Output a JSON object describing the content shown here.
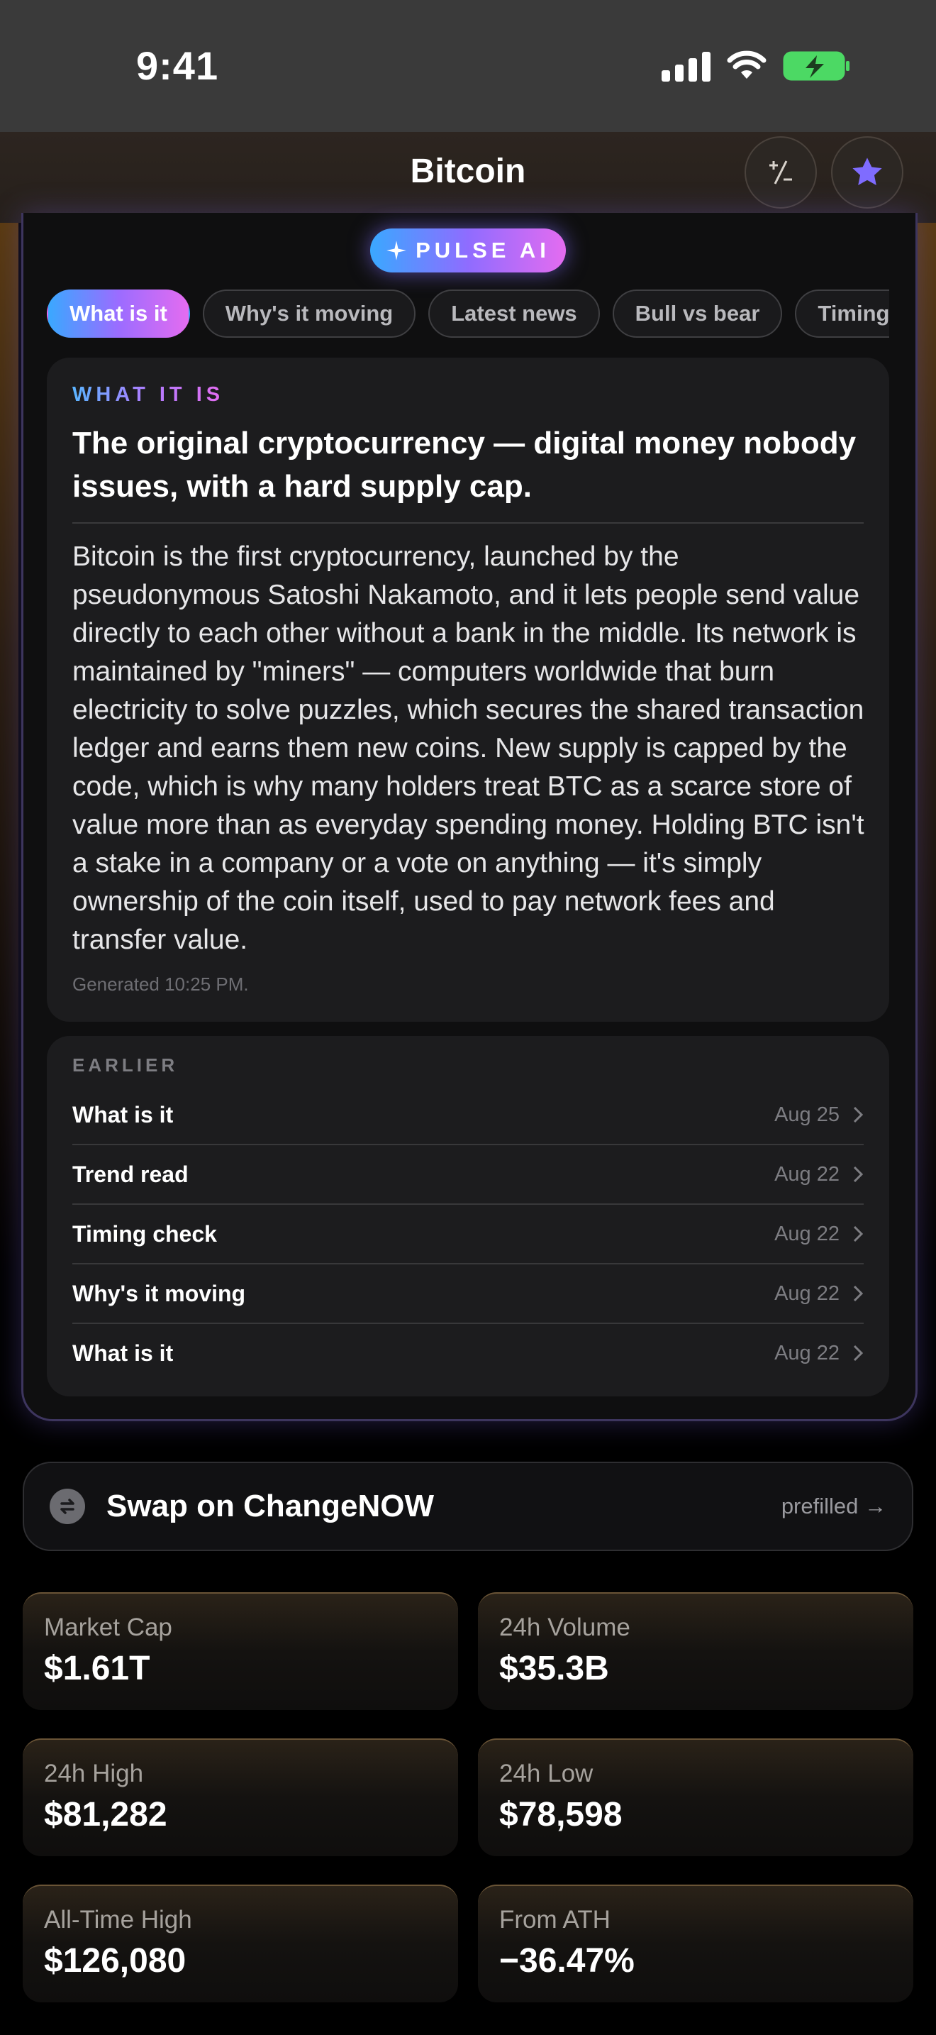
{
  "status_bar": {
    "time": "9:41"
  },
  "nav": {
    "title": "Bitcoin"
  },
  "pulse_ai": {
    "badge": "PULSE AI",
    "tabs": [
      "What is it",
      "Why's it moving",
      "Latest news",
      "Bull vs bear",
      "Timing check"
    ],
    "active_tab": 0,
    "eyebrow": "WHAT IT IS",
    "headline": "The original cryptocurrency — digital money nobody issues, with a hard supply cap.",
    "body": "Bitcoin is the first cryptocurrency, launched by the pseudonymous Satoshi Nakamoto, and it lets people send value directly to each other without a bank in the middle. Its network is maintained by \"miners\" — computers worldwide that burn electricity to solve puzzles, which secures the shared transaction ledger and earns them new coins. New supply is capped by the code, which is why many holders treat BTC as a scarce store of value more than as everyday spending money. Holding BTC isn't a stake in a company or a vote on anything — it's simply ownership of the coin itself, used to pay network fees and transfer value.",
    "generated": "Generated 10:25 PM.",
    "earlier_label": "EARLIER",
    "history": [
      {
        "label": "What is it",
        "date": "Aug 25"
      },
      {
        "label": "Trend read",
        "date": "Aug 22"
      },
      {
        "label": "Timing check",
        "date": "Aug 22"
      },
      {
        "label": "Why's it moving",
        "date": "Aug 22"
      },
      {
        "label": "What is it",
        "date": "Aug 22"
      }
    ]
  },
  "swap": {
    "label": "Swap on ChangeNOW",
    "prefilled": "prefilled →"
  },
  "stats": [
    {
      "key": "Market Cap",
      "value": "$1.61T"
    },
    {
      "key": "24h Volume",
      "value": "$35.3B"
    },
    {
      "key": "24h High",
      "value": "$81,282"
    },
    {
      "key": "24h Low",
      "value": "$78,598"
    },
    {
      "key": "All-Time High",
      "value": "$126,080"
    },
    {
      "key": "From ATH",
      "value": "−36.47%"
    }
  ],
  "colors": {
    "accent_blue": "#3aa8ff",
    "accent_purple": "#9b6cff",
    "accent_pink": "#e46cf0",
    "star": "#7f6cff",
    "battery": "#4cd964"
  },
  "icons": [
    "signal-icon",
    "wifi-icon",
    "battery-charging-icon",
    "plus-minus-icon",
    "star-icon",
    "sparkle-icon",
    "chevron-right-icon",
    "swap-icon"
  ]
}
